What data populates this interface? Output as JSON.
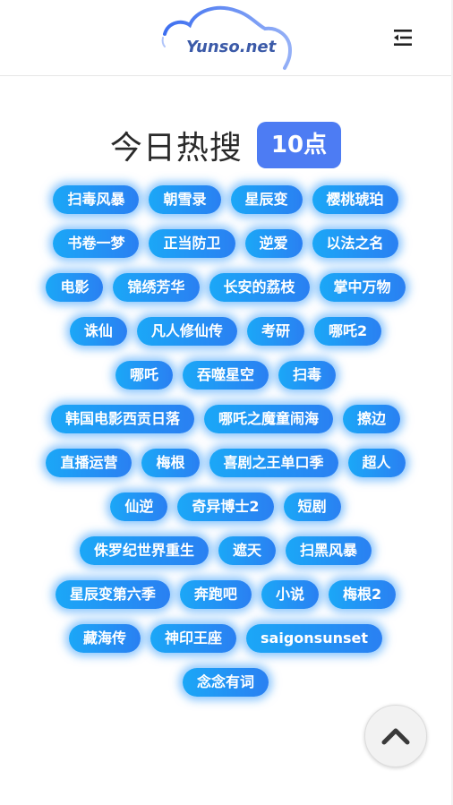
{
  "header": {
    "logo_text": "Yunso.net",
    "menu_icon": "menu-collapse-icon"
  },
  "hero": {
    "title": "今日热搜",
    "hour_badge": "10点"
  },
  "colors": {
    "brand": "#4d7cf3",
    "tag_start": "#1ba7f7",
    "tag_end": "#2a80f2",
    "logo_text": "#3b5aa8"
  },
  "tags": [
    "扫毒风暴",
    "朝雪录",
    "星辰变",
    "樱桃琥珀",
    "书卷一梦",
    "正当防卫",
    "逆爱",
    "以法之名",
    "电影",
    "锦绣芳华",
    "长安的荔枝",
    "掌中万物",
    "诛仙",
    "凡人修仙传",
    "考研",
    "哪吒2",
    "哪吒",
    "吞噬星空",
    "扫毒",
    "韩国电影西贡日落",
    "哪吒之魔童闹海",
    "擦边",
    "直播运营",
    "梅根",
    "喜剧之王单口季",
    "超人",
    "仙逆",
    "奇异博士2",
    "短剧",
    "侏罗纪世界重生",
    "遮天",
    "扫黑风暴",
    "星辰变第六季",
    "奔跑吧",
    "小说",
    "梅根2",
    "藏海传",
    "神印王座",
    "saigonsunset",
    "念念有词"
  ],
  "back_to_top": {
    "icon": "chevron-up-icon"
  }
}
